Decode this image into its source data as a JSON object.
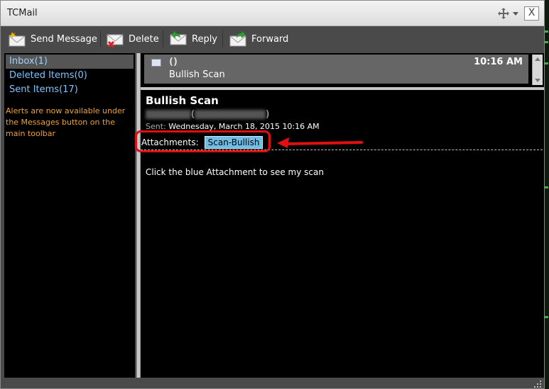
{
  "window": {
    "title": "TCMail",
    "close_label": "X"
  },
  "toolbar": {
    "send_label": "Send Message",
    "delete_label": "Delete",
    "reply_label": "Reply",
    "forward_label": "Forward"
  },
  "folders": [
    {
      "label": "Inbox(1)",
      "selected": true
    },
    {
      "label": "Deleted Items(0)"
    },
    {
      "label": "Sent Items(17)"
    }
  ],
  "notice": "Alerts are now available under the Messages button on the main toolbar",
  "message_list": [
    {
      "from": "(",
      "closing": ")",
      "time": "10:16 AM",
      "subject": "Bullish Scan"
    }
  ],
  "reader": {
    "subject": "Bullish Scan",
    "from_open": "(",
    "from_close": ")",
    "sent_label": "Sent:",
    "sent_value": "Wednesday, March 18, 2015 10:16 AM",
    "attachments_label": "Attachments:",
    "attachment": "Scan-Bullish",
    "body": "Click the blue Attachment to see my scan"
  },
  "colors": {
    "highlight": "#e01010",
    "attachment_bg": "#6fbde6",
    "folder_link": "#7fc4ff",
    "notice": "#f0a030"
  }
}
